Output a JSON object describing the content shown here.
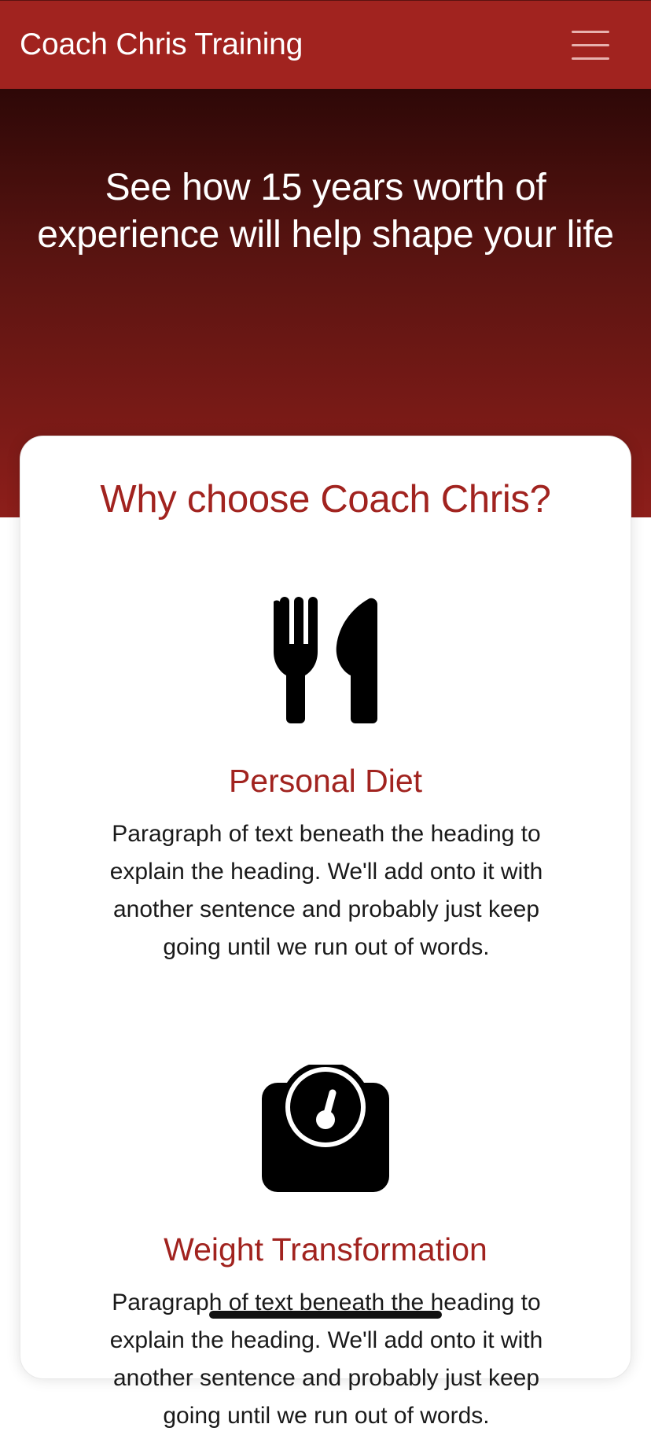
{
  "navbar": {
    "brand": "Coach Chris Training",
    "menu_icon": "hamburger-menu-icon"
  },
  "hero": {
    "title_line1": "See how 15 years worth of",
    "title_line2": "experience will help shape your life"
  },
  "why": {
    "title": "Why choose Coach Chris?",
    "features": [
      {
        "icon": "utensils-icon",
        "heading": "Personal Diet",
        "text": "Paragraph of text beneath the heading to explain the heading. We'll add onto it with another sentence and probably just keep going until we run out of words."
      },
      {
        "icon": "weight-scale-icon",
        "heading": "Weight Transformation",
        "text": "Paragraph of text beneath the heading to explain the heading. We'll add onto it with another sentence and probably just keep going until we run out of words."
      }
    ]
  },
  "colors": {
    "brand_red": "#a1231f",
    "hero_top": "#2e0807",
    "hero_bottom": "#8d1e1a"
  }
}
